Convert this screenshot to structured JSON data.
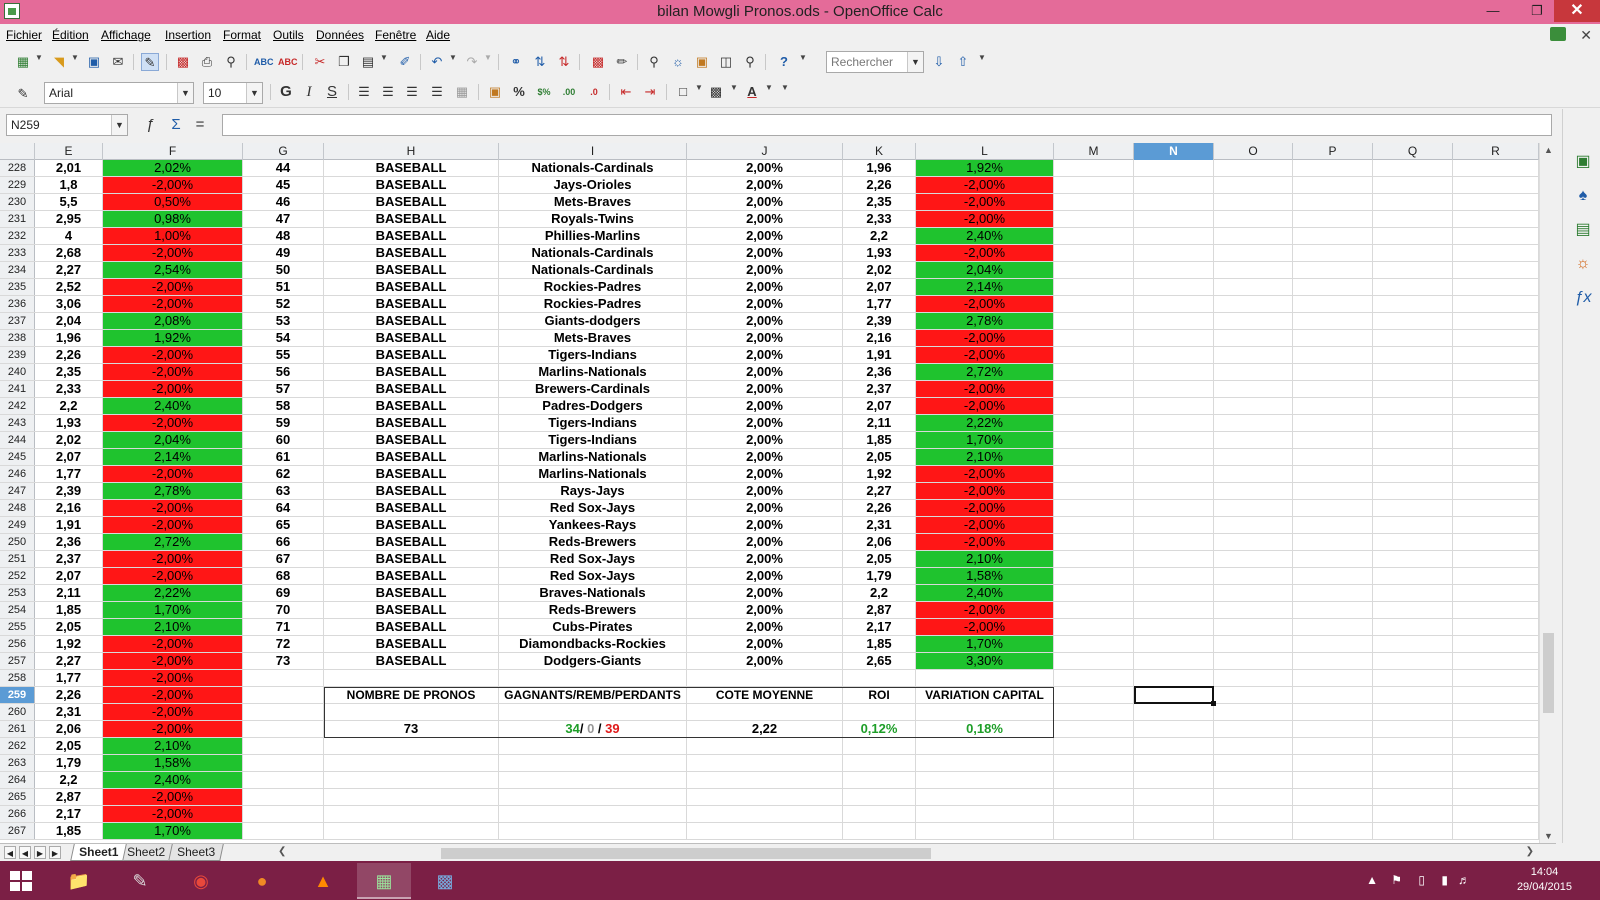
{
  "window": {
    "title": "bilan Mowgli Pronos.ods - OpenOffice Calc"
  },
  "menu": [
    "Fichier",
    "Édition",
    "Affichage",
    "Insertion",
    "Format",
    "Outils",
    "Données",
    "Fenêtre",
    "Aide"
  ],
  "toolbar": {
    "search_placeholder": "Rechercher"
  },
  "format_bar": {
    "font_name": "Arial",
    "font_size": "10",
    "bold_label": "G",
    "italic_label": "I",
    "underline_label": "S"
  },
  "formula_bar": {
    "cell_ref": "N259",
    "content": ""
  },
  "columns": [
    "E",
    "F",
    "G",
    "H",
    "I",
    "J",
    "K",
    "L",
    "M",
    "N",
    "O",
    "P",
    "Q",
    "R"
  ],
  "selected_column": "N",
  "selected_row": 259,
  "rows": [
    {
      "n": 228,
      "e": "2,01",
      "f": "2,02%",
      "fs": "pos",
      "g": "44",
      "h": "BASEBALL",
      "i": "Nationals-Cardinals",
      "j": "2,00%",
      "k": "1,96",
      "l": "1,92%",
      "ls": "pos"
    },
    {
      "n": 229,
      "e": "1,8",
      "f": "-2,00%",
      "fs": "neg",
      "g": "45",
      "h": "BASEBALL",
      "i": "Jays-Orioles",
      "j": "2,00%",
      "k": "2,26",
      "l": "-2,00%",
      "ls": "neg"
    },
    {
      "n": 230,
      "e": "5,5",
      "f": "0,50%",
      "fs": "neg",
      "g": "46",
      "h": "BASEBALL",
      "i": "Mets-Braves",
      "j": "2,00%",
      "k": "2,35",
      "l": "-2,00%",
      "ls": "neg"
    },
    {
      "n": 231,
      "e": "2,95",
      "f": "0,98%",
      "fs": "pos",
      "g": "47",
      "h": "BASEBALL",
      "i": "Royals-Twins",
      "j": "2,00%",
      "k": "2,33",
      "l": "-2,00%",
      "ls": "neg"
    },
    {
      "n": 232,
      "e": "4",
      "f": "1,00%",
      "fs": "neg",
      "g": "48",
      "h": "BASEBALL",
      "i": "Phillies-Marlins",
      "j": "2,00%",
      "k": "2,2",
      "l": "2,40%",
      "ls": "pos"
    },
    {
      "n": 233,
      "e": "2,68",
      "f": "-2,00%",
      "fs": "neg",
      "g": "49",
      "h": "BASEBALL",
      "i": "Nationals-Cardinals",
      "j": "2,00%",
      "k": "1,93",
      "l": "-2,00%",
      "ls": "neg"
    },
    {
      "n": 234,
      "e": "2,27",
      "f": "2,54%",
      "fs": "pos",
      "g": "50",
      "h": "BASEBALL",
      "i": "Nationals-Cardinals",
      "j": "2,00%",
      "k": "2,02",
      "l": "2,04%",
      "ls": "pos"
    },
    {
      "n": 235,
      "e": "2,52",
      "f": "-2,00%",
      "fs": "neg",
      "g": "51",
      "h": "BASEBALL",
      "i": "Rockies-Padres",
      "j": "2,00%",
      "k": "2,07",
      "l": "2,14%",
      "ls": "pos"
    },
    {
      "n": 236,
      "e": "3,06",
      "f": "-2,00%",
      "fs": "neg",
      "g": "52",
      "h": "BASEBALL",
      "i": "Rockies-Padres",
      "j": "2,00%",
      "k": "1,77",
      "l": "-2,00%",
      "ls": "neg"
    },
    {
      "n": 237,
      "e": "2,04",
      "f": "2,08%",
      "fs": "pos",
      "g": "53",
      "h": "BASEBALL",
      "i": "Giants-dodgers",
      "j": "2,00%",
      "k": "2,39",
      "l": "2,78%",
      "ls": "pos"
    },
    {
      "n": 238,
      "e": "1,96",
      "f": "1,92%",
      "fs": "pos",
      "g": "54",
      "h": "BASEBALL",
      "i": "Mets-Braves",
      "j": "2,00%",
      "k": "2,16",
      "l": "-2,00%",
      "ls": "neg"
    },
    {
      "n": 239,
      "e": "2,26",
      "f": "-2,00%",
      "fs": "neg",
      "g": "55",
      "h": "BASEBALL",
      "i": "Tigers-Indians",
      "j": "2,00%",
      "k": "1,91",
      "l": "-2,00%",
      "ls": "neg"
    },
    {
      "n": 240,
      "e": "2,35",
      "f": "-2,00%",
      "fs": "neg",
      "g": "56",
      "h": "BASEBALL",
      "i": "Marlins-Nationals",
      "j": "2,00%",
      "k": "2,36",
      "l": "2,72%",
      "ls": "pos"
    },
    {
      "n": 241,
      "e": "2,33",
      "f": "-2,00%",
      "fs": "neg",
      "g": "57",
      "h": "BASEBALL",
      "i": "Brewers-Cardinals",
      "j": "2,00%",
      "k": "2,37",
      "l": "-2,00%",
      "ls": "neg"
    },
    {
      "n": 242,
      "e": "2,2",
      "f": "2,40%",
      "fs": "pos",
      "g": "58",
      "h": "BASEBALL",
      "i": "Padres-Dodgers",
      "j": "2,00%",
      "k": "2,07",
      "l": "-2,00%",
      "ls": "neg"
    },
    {
      "n": 243,
      "e": "1,93",
      "f": "-2,00%",
      "fs": "neg",
      "g": "59",
      "h": "BASEBALL",
      "i": "Tigers-Indians",
      "j": "2,00%",
      "k": "2,11",
      "l": "2,22%",
      "ls": "pos"
    },
    {
      "n": 244,
      "e": "2,02",
      "f": "2,04%",
      "fs": "pos",
      "g": "60",
      "h": "BASEBALL",
      "i": "Tigers-Indians",
      "j": "2,00%",
      "k": "1,85",
      "l": "1,70%",
      "ls": "pos"
    },
    {
      "n": 245,
      "e": "2,07",
      "f": "2,14%",
      "fs": "pos",
      "g": "61",
      "h": "BASEBALL",
      "i": "Marlins-Nationals",
      "j": "2,00%",
      "k": "2,05",
      "l": "2,10%",
      "ls": "pos"
    },
    {
      "n": 246,
      "e": "1,77",
      "f": "-2,00%",
      "fs": "neg",
      "g": "62",
      "h": "BASEBALL",
      "i": "Marlins-Nationals",
      "j": "2,00%",
      "k": "1,92",
      "l": "-2,00%",
      "ls": "neg"
    },
    {
      "n": 247,
      "e": "2,39",
      "f": "2,78%",
      "fs": "pos",
      "g": "63",
      "h": "BASEBALL",
      "i": "Rays-Jays",
      "j": "2,00%",
      "k": "2,27",
      "l": "-2,00%",
      "ls": "neg"
    },
    {
      "n": 248,
      "e": "2,16",
      "f": "-2,00%",
      "fs": "neg",
      "g": "64",
      "h": "BASEBALL",
      "i": "Red Sox-Jays",
      "j": "2,00%",
      "k": "2,26",
      "l": "-2,00%",
      "ls": "neg"
    },
    {
      "n": 249,
      "e": "1,91",
      "f": "-2,00%",
      "fs": "neg",
      "g": "65",
      "h": "BASEBALL",
      "i": "Yankees-Rays",
      "j": "2,00%",
      "k": "2,31",
      "l": "-2,00%",
      "ls": "neg"
    },
    {
      "n": 250,
      "e": "2,36",
      "f": "2,72%",
      "fs": "pos",
      "g": "66",
      "h": "BASEBALL",
      "i": "Reds-Brewers",
      "j": "2,00%",
      "k": "2,06",
      "l": "-2,00%",
      "ls": "neg"
    },
    {
      "n": 251,
      "e": "2,37",
      "f": "-2,00%",
      "fs": "neg",
      "g": "67",
      "h": "BASEBALL",
      "i": "Red Sox-Jays",
      "j": "2,00%",
      "k": "2,05",
      "l": "2,10%",
      "ls": "pos"
    },
    {
      "n": 252,
      "e": "2,07",
      "f": "-2,00%",
      "fs": "neg",
      "g": "68",
      "h": "BASEBALL",
      "i": "Red Sox-Jays",
      "j": "2,00%",
      "k": "1,79",
      "l": "1,58%",
      "ls": "pos"
    },
    {
      "n": 253,
      "e": "2,11",
      "f": "2,22%",
      "fs": "pos",
      "g": "69",
      "h": "BASEBALL",
      "i": "Braves-Nationals",
      "j": "2,00%",
      "k": "2,2",
      "l": "2,40%",
      "ls": "pos"
    },
    {
      "n": 254,
      "e": "1,85",
      "f": "1,70%",
      "fs": "pos",
      "g": "70",
      "h": "BASEBALL",
      "i": "Reds-Brewers",
      "j": "2,00%",
      "k": "2,87",
      "l": "-2,00%",
      "ls": "neg"
    },
    {
      "n": 255,
      "e": "2,05",
      "f": "2,10%",
      "fs": "pos",
      "g": "71",
      "h": "BASEBALL",
      "i": "Cubs-Pirates",
      "j": "2,00%",
      "k": "2,17",
      "l": "-2,00%",
      "ls": "neg"
    },
    {
      "n": 256,
      "e": "1,92",
      "f": "-2,00%",
      "fs": "neg",
      "g": "72",
      "h": "BASEBALL",
      "i": "Diamondbacks-Rockies",
      "j": "2,00%",
      "k": "1,85",
      "l": "1,70%",
      "ls": "pos"
    },
    {
      "n": 257,
      "e": "2,27",
      "f": "-2,00%",
      "fs": "neg",
      "g": "73",
      "h": "BASEBALL",
      "i": "Dodgers-Giants",
      "j": "2,00%",
      "k": "2,65",
      "l": "3,30%",
      "ls": "pos"
    },
    {
      "n": 258,
      "e": "1,77",
      "f": "-2,00%",
      "fs": "neg"
    },
    {
      "n": 259,
      "e": "2,26",
      "f": "-2,00%",
      "fs": "neg"
    },
    {
      "n": 260,
      "e": "2,31",
      "f": "-2,00%",
      "fs": "neg"
    },
    {
      "n": 261,
      "e": "2,06",
      "f": "-2,00%",
      "fs": "neg"
    },
    {
      "n": 262,
      "e": "2,05",
      "f": "2,10%",
      "fs": "pos"
    },
    {
      "n": 263,
      "e": "1,79",
      "f": "1,58%",
      "fs": "pos"
    },
    {
      "n": 264,
      "e": "2,2",
      "f": "2,40%",
      "fs": "pos"
    },
    {
      "n": 265,
      "e": "2,87",
      "f": "-2,00%",
      "fs": "neg"
    },
    {
      "n": 266,
      "e": "2,17",
      "f": "-2,00%",
      "fs": "neg"
    },
    {
      "n": 267,
      "e": "1,85",
      "f": "1,70%",
      "fs": "pos"
    }
  ],
  "summary": {
    "headers": [
      "NOMBRE DE PRONOS",
      "GAGNANTS/REMB/PERDANTS",
      "COTE MOYENNE",
      "ROI",
      "VARIATION CAPITAL"
    ],
    "count": "73",
    "wins": "34",
    "sep1": "/ ",
    "refunds": "0",
    "sep2": " / ",
    "losses": "39",
    "avg_odds": "2,22",
    "roi": "0,12%",
    "capital_variation": "0,18%"
  },
  "sheets": [
    "Sheet1",
    "Sheet2",
    "Sheet3"
  ],
  "active_sheet": "Sheet1",
  "taskbar": {
    "time": "14:04",
    "date": "29/04/2015"
  },
  "colors": {
    "positive": "#1fc32e",
    "negative": "#ff1616",
    "titlebar": "#e46b99",
    "taskbar": "#7b1f45",
    "selection": "#5b9bd5"
  }
}
